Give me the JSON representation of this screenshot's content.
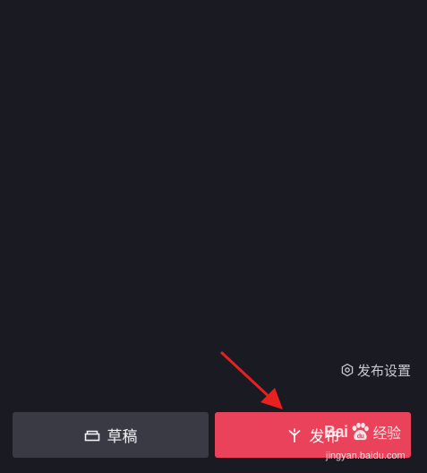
{
  "publish_settings": {
    "label": "发布设置",
    "icon": "hexagon-settings-icon"
  },
  "buttons": {
    "draft_label": "草稿",
    "draft_icon": "draft-box-icon",
    "publish_label": "发布",
    "publish_icon": "sparkle-icon"
  },
  "colors": {
    "background": "#1a1a23",
    "draft_button": "#3a3a44",
    "publish_button": "#e9425a",
    "annotation_arrow": "#e8201f"
  },
  "watermark": {
    "brand_prefix": "Bai",
    "brand_suffix": "经验",
    "url": "jingyan.baidu.com"
  }
}
